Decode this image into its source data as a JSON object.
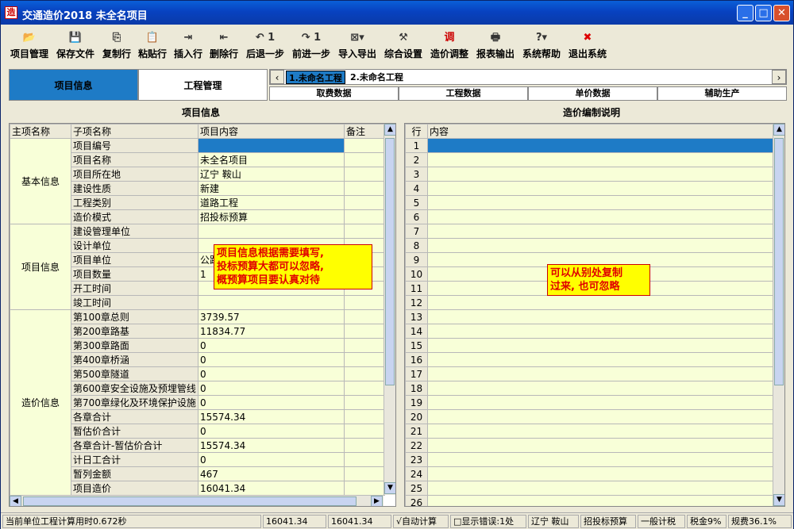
{
  "window": {
    "title": "交通造价2018  未全名项目",
    "app_icon": "造"
  },
  "toolbar": [
    {
      "label": "项目管理",
      "icon": "📂"
    },
    {
      "label": "保存文件",
      "icon": "💾"
    },
    {
      "label": "复制行",
      "icon": "⎘"
    },
    {
      "label": "粘贴行",
      "icon": "📋"
    },
    {
      "label": "插入行",
      "icon": "⇥"
    },
    {
      "label": "删除行",
      "icon": "⇤"
    },
    {
      "label": "后退一步",
      "icon": "↶ 1"
    },
    {
      "label": "前进一步",
      "icon": "↷ 1"
    },
    {
      "label": "导入导出",
      "icon": "⊠▾"
    },
    {
      "label": "综合设置",
      "icon": "⚒"
    },
    {
      "label": "造价调整",
      "icon": "调"
    },
    {
      "label": "报表输出",
      "icon": "🖶"
    },
    {
      "label": "系统帮助",
      "icon": "?▾"
    },
    {
      "label": "退出系统",
      "icon": "✖"
    }
  ],
  "nav": {
    "left1": "项目信息",
    "left2": "工程管理"
  },
  "project_tabs": [
    "1.未命名工程",
    "2.未命名工程"
  ],
  "sub_tabs": [
    "取费数据",
    "工程数据",
    "单价数据",
    "辅助生产"
  ],
  "left_section_title": "项目信息",
  "right_section_title": "造价编制说明",
  "left_table": {
    "headers": [
      "主项名称",
      "子项名称",
      "项目内容",
      "备注"
    ],
    "groups": [
      {
        "main": "基本信息",
        "rows": [
          {
            "sub": "项目编号",
            "value": ""
          },
          {
            "sub": "项目名称",
            "value": "未全名项目"
          },
          {
            "sub": "项目所在地",
            "value": "辽宁 鞍山"
          },
          {
            "sub": "建设性质",
            "value": "新建"
          },
          {
            "sub": "工程类别",
            "value": "道路工程"
          },
          {
            "sub": "造价模式",
            "value": "招投标预算"
          }
        ]
      },
      {
        "main": "项目信息",
        "rows": [
          {
            "sub": "建设管理单位",
            "value": ""
          },
          {
            "sub": "设计单位",
            "value": ""
          },
          {
            "sub": "项目单位",
            "value": "公路"
          },
          {
            "sub": "项目数量",
            "value": "1"
          },
          {
            "sub": "开工时间",
            "value": ""
          },
          {
            "sub": "竣工时间",
            "value": ""
          }
        ]
      },
      {
        "main": "造价信息",
        "rows": [
          {
            "sub": "第100章总则",
            "value": "3739.57"
          },
          {
            "sub": "第200章路基",
            "value": "11834.77"
          },
          {
            "sub": "第300章路面",
            "value": "0"
          },
          {
            "sub": "第400章桥涵",
            "value": "0"
          },
          {
            "sub": "第500章隧道",
            "value": "0"
          },
          {
            "sub": "第600章安全设施及预埋管线",
            "value": "0"
          },
          {
            "sub": "第700章绿化及环境保护设施",
            "value": "0"
          },
          {
            "sub": "各章合计",
            "value": "15574.34"
          },
          {
            "sub": "暂估价合计",
            "value": "0"
          },
          {
            "sub": "各章合计-暂估价合计",
            "value": "15574.34"
          },
          {
            "sub": "计日工合计",
            "value": "0"
          },
          {
            "sub": "暂列金额",
            "value": "467"
          },
          {
            "sub": "项目造价",
            "value": "16041.34"
          }
        ]
      }
    ]
  },
  "right_table": {
    "headers": [
      "行",
      "内容"
    ],
    "rows": [
      "1",
      "2",
      "3",
      "4",
      "5",
      "6",
      "7",
      "8",
      "9",
      "10",
      "11",
      "12",
      "13",
      "14",
      "15",
      "16",
      "17",
      "18",
      "19",
      "20",
      "21",
      "22",
      "23",
      "24",
      "25",
      "26"
    ]
  },
  "notes": {
    "left": [
      "项目信息根据需要填写,",
      "投标预算大都可以忽略,",
      "概预算项目要认真对待"
    ],
    "right": [
      "可以从别处复制",
      "过来, 也可忽略"
    ]
  },
  "status": [
    "当前单位工程计算用时0.672秒",
    "16041.34",
    "16041.34",
    "√自动计算",
    "□显示错误:1处",
    "辽宁 鞍山",
    "招投标预算",
    "一般计税",
    "税金9%",
    "规费36.1%"
  ]
}
